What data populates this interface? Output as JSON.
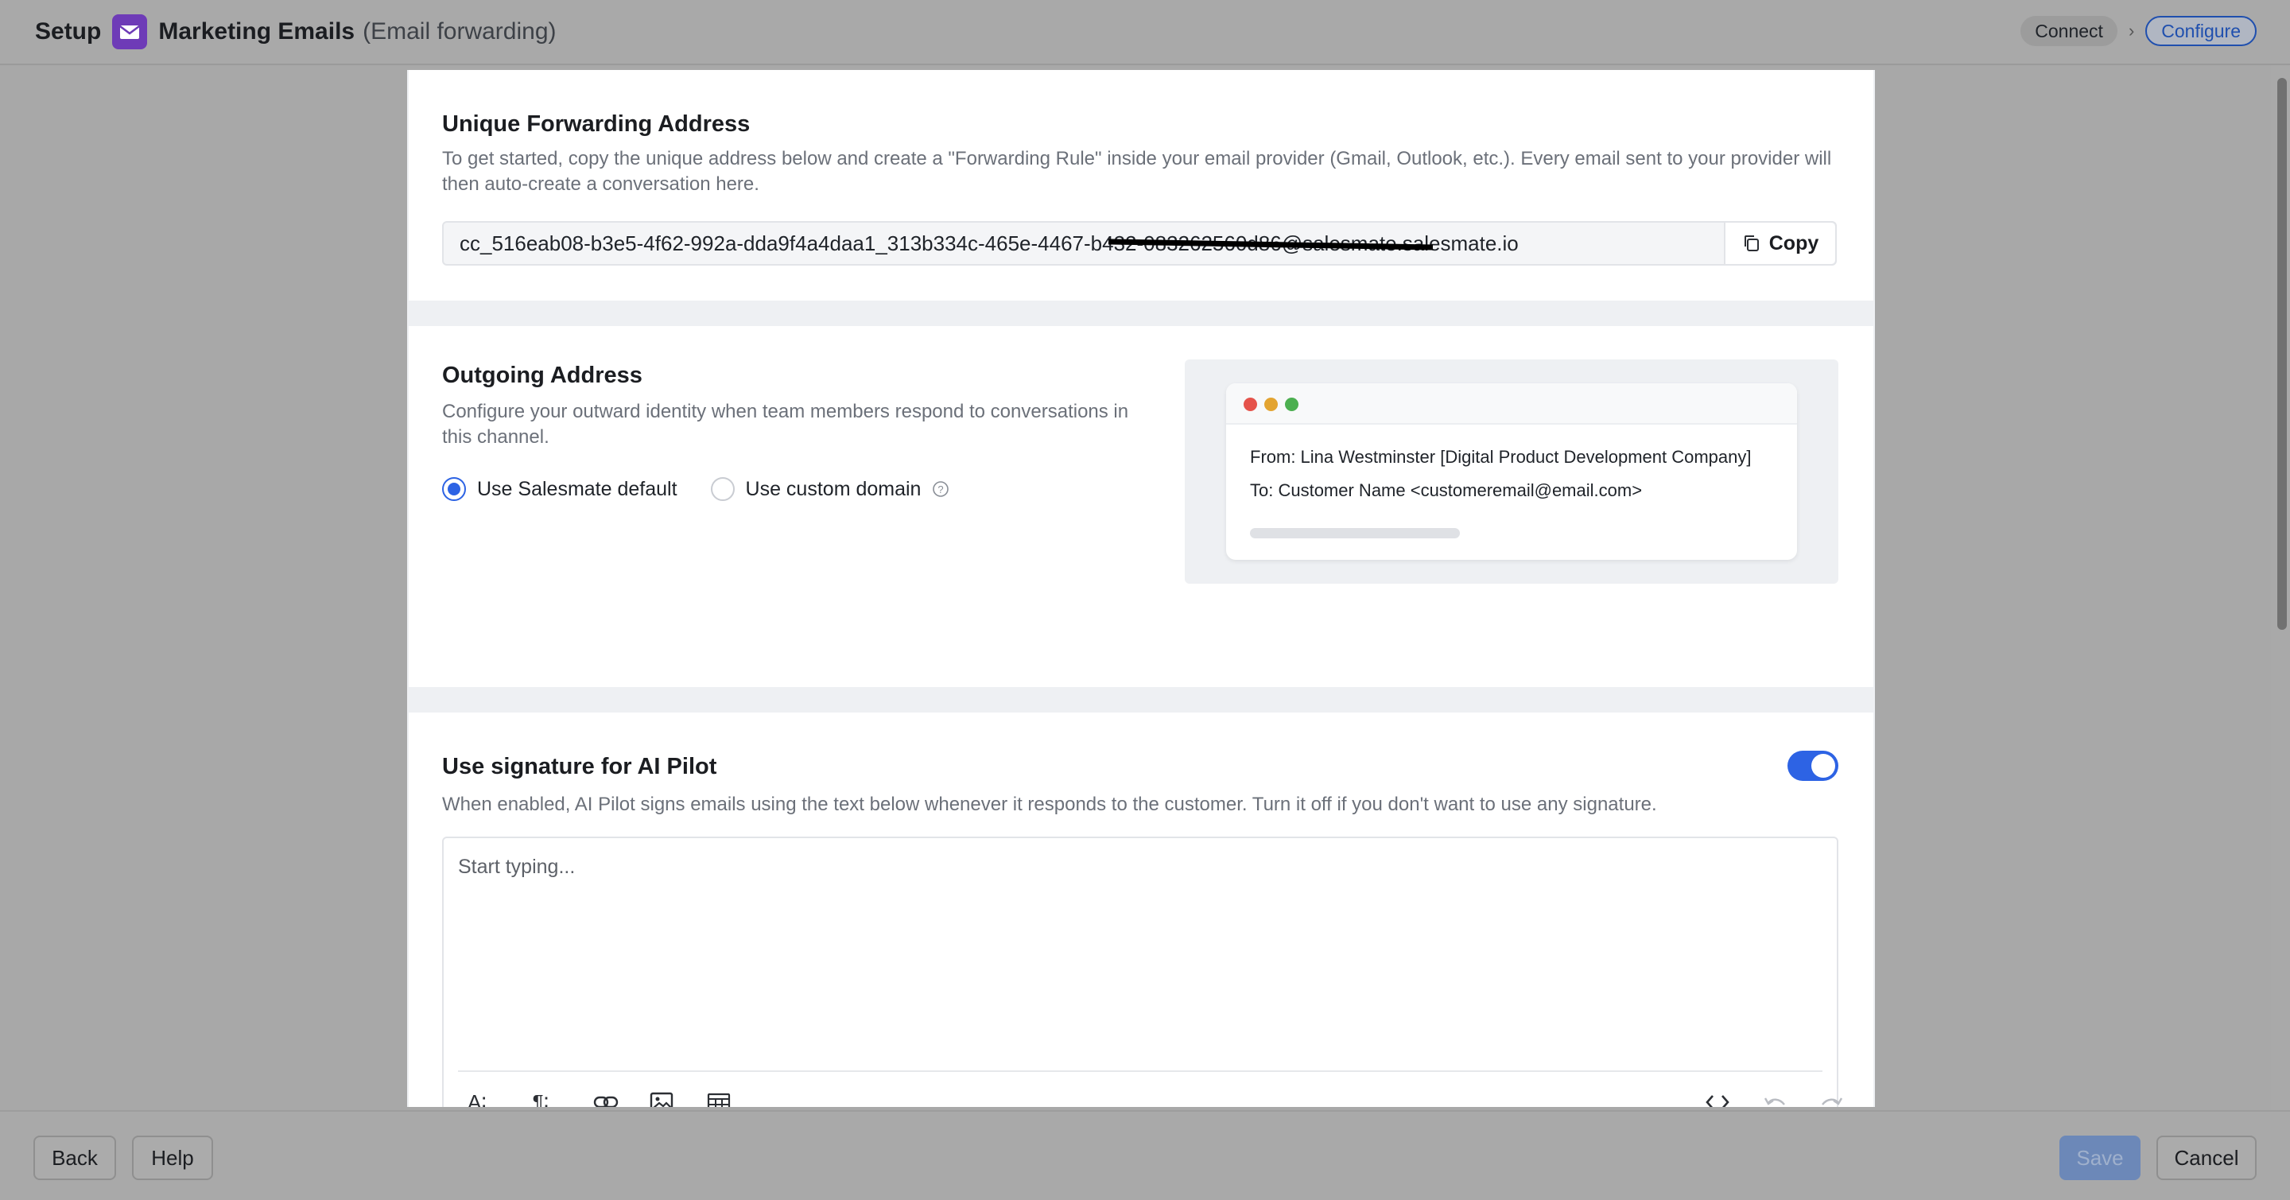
{
  "header": {
    "setup_label": "Setup",
    "channel_name": "Marketing Emails",
    "channel_type": "(Email forwarding)",
    "app_icon": "envelope-icon",
    "steps": [
      "Connect",
      "Configure"
    ],
    "active_step": "Configure"
  },
  "forwarding": {
    "title": "Unique Forwarding Address",
    "description": "To get started, copy the unique address below and create a \"Forwarding Rule\" inside your email provider (Gmail, Outlook, etc.). Every email sent to your provider will then auto-create a conversation here.",
    "address": "cc_516eab08-b3e5-4f62-992a-dda9f4a4daa1_313b334c-465e-4467-b432-083262560d86@salesmate.salesmate.io",
    "copy_label": "Copy"
  },
  "outgoing": {
    "title": "Outgoing Address",
    "description": "Configure your outward identity when team members respond to conversations in this channel.",
    "options": [
      "Use Salesmate default",
      "Use custom domain"
    ],
    "selected": "Use Salesmate default",
    "preview": {
      "from": "From: Lina Westminster [Digital Product Development Company]",
      "to": "To: Customer Name <customeremail@email.com>"
    }
  },
  "signature": {
    "title": "Use signature for AI Pilot",
    "description": "When enabled, AI Pilot signs emails using the text below whenever it responds to the customer. Turn it off if you don't want to use any signature.",
    "enabled": true,
    "placeholder": "Start typing...",
    "toolbar": {
      "font_size": "A∶",
      "paragraph": "¶∶"
    }
  },
  "footer": {
    "back_label": "Back",
    "help_label": "Help",
    "save_label": "Save",
    "cancel_label": "Cancel"
  },
  "colors": {
    "accent": "#2d63e4",
    "brand": "#6e3bb7",
    "dot_red": "#e5534b",
    "dot_yellow": "#e3a431",
    "dot_green": "#4caf50"
  }
}
